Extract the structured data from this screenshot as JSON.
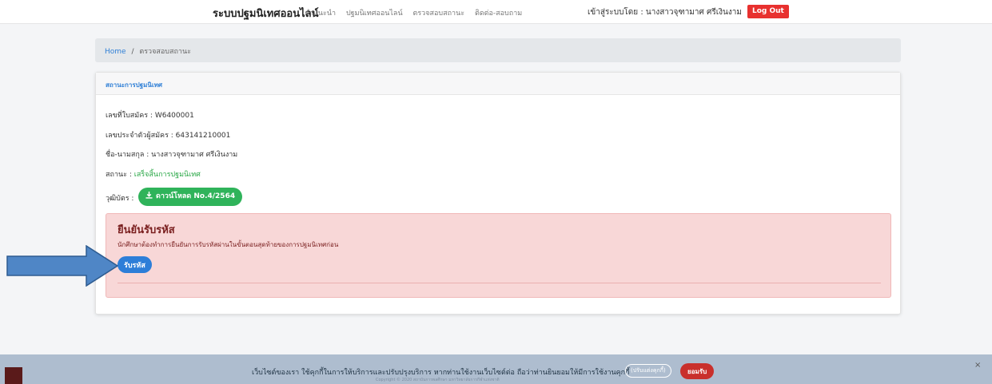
{
  "navbar": {
    "brand": "ระบบปฐมนิเทศออนไลน์",
    "links": [
      "คำแนะนำ",
      "ปฐมนิเทศออนไลน์",
      "ตรวจสอบสถานะ",
      "ติดต่อ-สอบถาม"
    ],
    "login_info": "เข้าสู่ระบบโดย : นางสาวจุฑามาศ ศรีเงินงาม",
    "logout_label": "Log Out"
  },
  "breadcrumb": {
    "home": "Home",
    "separator": "/",
    "current": "ตรวจสอบสถานะ"
  },
  "card": {
    "header": "สถานะการปฐมนิเทศ",
    "application_no": "เลขที่ใบสมัคร : W6400001",
    "applicant_id": "เลขประจำตัวผู้สมัคร : 643141210001",
    "name": "ชื่อ-นามสกุล : นางสาวจุฑามาศ ศรีเงินงาม",
    "status_label": "สถานะ : ",
    "status_value": "เสร็จสิ้นการปฐมนิเทศ",
    "certificate_label": "วุฒิบัตร :",
    "download_label": "ดาวน์โหลด No.4/2564"
  },
  "alert": {
    "title": "ยืนยันรับรหัส",
    "text": "นักศึกษาต้องทำการยืนยันการรับรหัสผ่านในขั้นตอนสุดท้ายของการปฐมนิเทศก่อน",
    "button_label": "รับรหัส"
  },
  "cookie": {
    "text": "เว็บไซต์ของเรา ใช้คุกกี้ในการให้บริการและปรับปรุงบริการ หากท่านใช้งานเว็บไซต์ต่อ ถือว่าท่านยินยอมให้มีการใช้งานคุกกี้",
    "subtext": "Copyright © 2020 สถาบันการพลศึกษา มหาวิทยาลัยการกีฬาแห่งชาติ",
    "settings_label": "(ปรับแต่งคุกกี้)",
    "accept_label": "ยอมรับ",
    "close_label": "×"
  },
  "colors": {
    "accent_blue": "#2f7fd6",
    "logout_red": "#e8312f",
    "success_green": "#2fb35a",
    "alert_bg": "#f8d7d7",
    "arrow_blue": "#4f86c6"
  }
}
